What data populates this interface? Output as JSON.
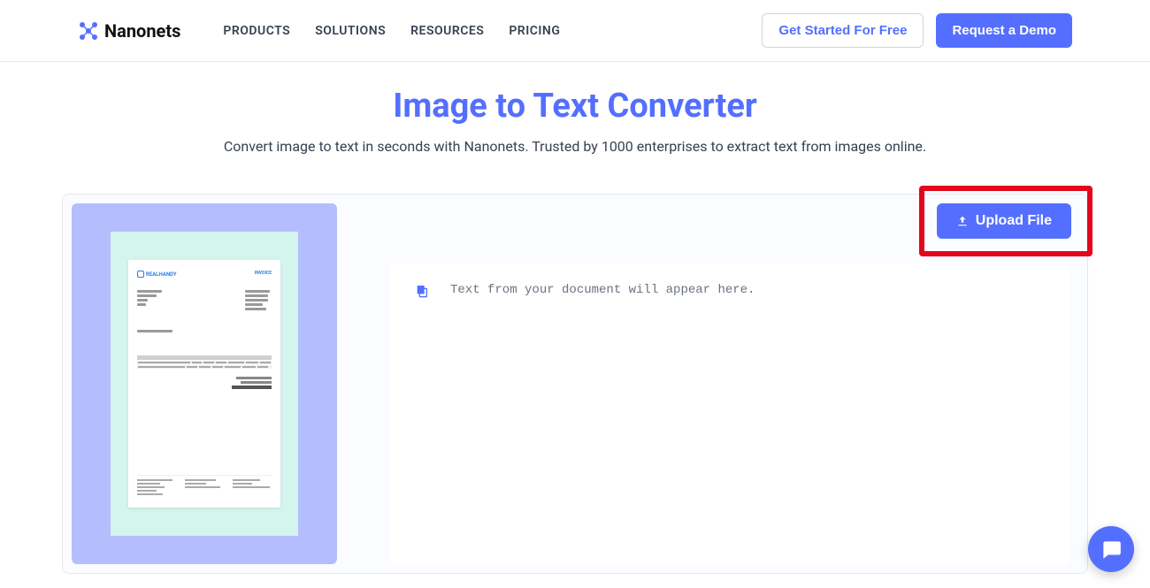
{
  "header": {
    "brand": "Nanonets",
    "nav": [
      "PRODUCTS",
      "SOLUTIONS",
      "RESOURCES",
      "PRICING"
    ],
    "cta_outline": "Get Started For Free",
    "cta_primary": "Request a Demo"
  },
  "hero": {
    "title": "Image to Text Converter",
    "subtitle": "Convert image to text in seconds with Nanonets. Trusted by 1000 enterprises to extract text from images online."
  },
  "upload": {
    "label": "Upload File"
  },
  "output": {
    "placeholder": "Text from your document will appear here."
  },
  "sample_doc": {
    "brand": "REALHANDY",
    "doc_type": "INVOICE"
  },
  "colors": {
    "accent": "#546fff",
    "highlight": "#e3061a"
  }
}
